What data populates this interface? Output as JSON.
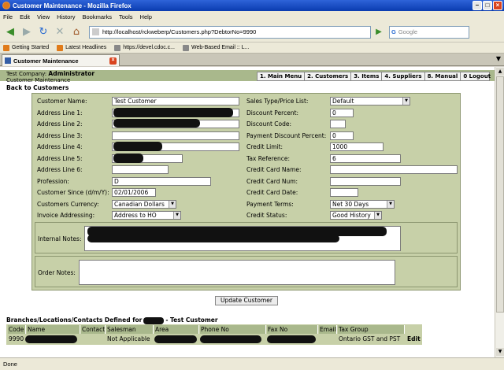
{
  "window": {
    "title": "Customer Maintenance - Mozilla Firefox"
  },
  "menubar": [
    "File",
    "Edit",
    "View",
    "History",
    "Bookmarks",
    "Tools",
    "Help"
  ],
  "nav": {
    "url": "http://localhost/rckweberp/Customers.php?DebtorNo=9990",
    "search_placeholder": "Google"
  },
  "bookmarks": [
    "Getting Started",
    "Latest Headlines",
    "https://devel.cdoc.c...",
    "Web-Based Email :: L..."
  ],
  "tab": {
    "title": "Customer Maintenance"
  },
  "page": {
    "company_label": "Test Company:",
    "company_user": "Administrator",
    "page_name": "Customer Maintenance",
    "menu": [
      "1. Main Menu",
      "2. Customers",
      "3. Items",
      "4. Suppliers",
      "8. Manual",
      "0 Logout"
    ],
    "back_link": "Back to Customers"
  },
  "form": {
    "left": {
      "name_label": "Customer Name:",
      "name_value": "Test Customer",
      "addr1_label": "Address Line 1:",
      "addr2_label": "Address Line 2:",
      "addr3_label": "Address Line 3:",
      "addr4_label": "Address Line 4:",
      "addr5_label": "Address Line 5:",
      "addr6_label": "Address Line 6:",
      "profession_label": "Profession:",
      "profession_value": "D",
      "since_label": "Customer Since (d/m/Y):",
      "since_value": "02/01/2006",
      "currency_label": "Customers Currency:",
      "currency_value": "Canadian Dollars",
      "invoice_label": "Invoice Addressing:",
      "invoice_value": "Address to HO"
    },
    "right": {
      "salestype_label": "Sales Type/Price List:",
      "salestype_value": "Default",
      "discount_label": "Discount Percent:",
      "discount_value": "0",
      "disccode_label": "Discount Code:",
      "disccode_value": "",
      "paydisc_label": "Payment Discount Percent:",
      "paydisc_value": "0",
      "credit_label": "Credit Limit:",
      "credit_value": "1000",
      "taxref_label": "Tax Reference:",
      "taxref_value": "6",
      "ccname_label": "Credit Card Name:",
      "ccnum_label": "Credit Card Num:",
      "ccdate_label": "Credit Card Date:",
      "terms_label": "Payment Terms:",
      "terms_value": "Net 30 Days",
      "status_label": "Credit Status:",
      "status_value": "Good History"
    },
    "internal_notes_label": "Internal Notes:",
    "order_notes_label": "Order Notes:",
    "update_button": "Update Customer"
  },
  "branches": {
    "title_prefix": "Branches/Locations/Contacts Defined for",
    "title_suffix": "- Test Customer",
    "headers": [
      "Code",
      "Name",
      "Contact",
      "Salesman",
      "Area",
      "Phone No",
      "Fax No",
      "Email",
      "Tax Group"
    ],
    "row": {
      "code": "9990",
      "salesman": "Not Applicable",
      "tax_group": "Ontario GST and PST",
      "edit": "Edit"
    }
  },
  "status": {
    "text": "Done"
  }
}
